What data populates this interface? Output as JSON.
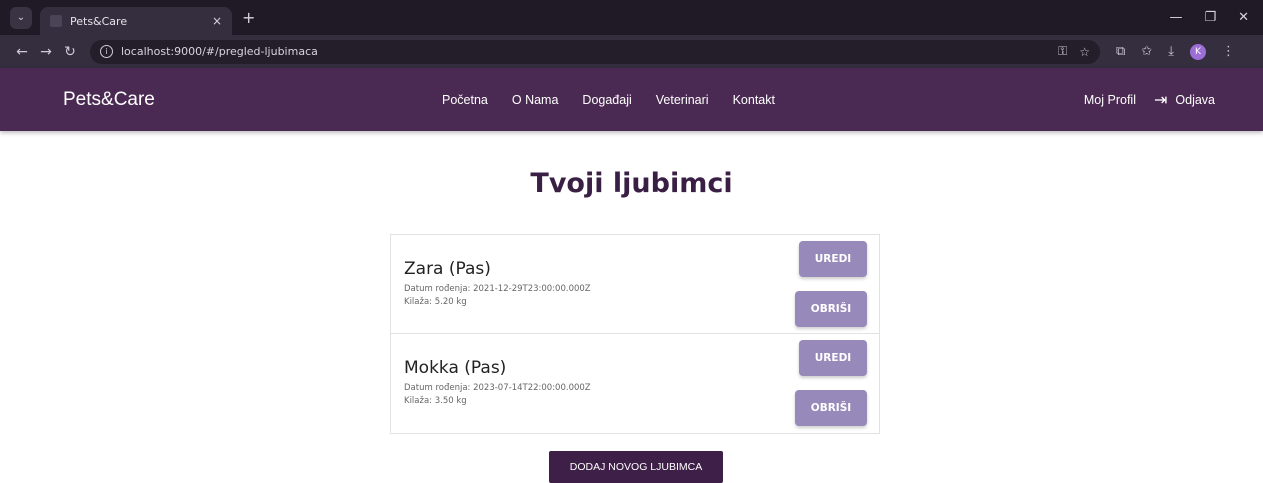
{
  "browser": {
    "tab_title": "Pets&Care",
    "tab_close": "×",
    "new_tab": "+",
    "url": "localhost:9000/#/pregled-ljubimaca",
    "profile_initial": "K"
  },
  "header": {
    "brand": "Pets&Care",
    "nav": [
      {
        "label": "Početna"
      },
      {
        "label": "O Nama"
      },
      {
        "label": "Događaji"
      },
      {
        "label": "Veterinari"
      },
      {
        "label": "Kontakt"
      }
    ],
    "profile_label": "Moj Profil",
    "logout_label": "Odjava"
  },
  "page": {
    "title": "Tvoji ljubimci",
    "add_button": "DODAJ NOVOG LJUBIMCA"
  },
  "pets": [
    {
      "name": "Zara (Pas)",
      "dob": "Datum rođenja: 2021-12-29T23:00:00.000Z",
      "weight": "Kilaža: 5.20 kg",
      "edit": "UREDI",
      "delete": "OBRIŠI"
    },
    {
      "name": "Mokka (Pas)",
      "dob": "Datum rođenja: 2023-07-14T22:00:00.000Z",
      "weight": "Kilaža: 3.50 kg",
      "edit": "UREDI",
      "delete": "OBRIŠI"
    }
  ],
  "colors": {
    "header_bg": "#4a2a52",
    "button_bg": "#9789ba",
    "add_button_bg": "#3e1f47",
    "title": "#3a1f44"
  }
}
